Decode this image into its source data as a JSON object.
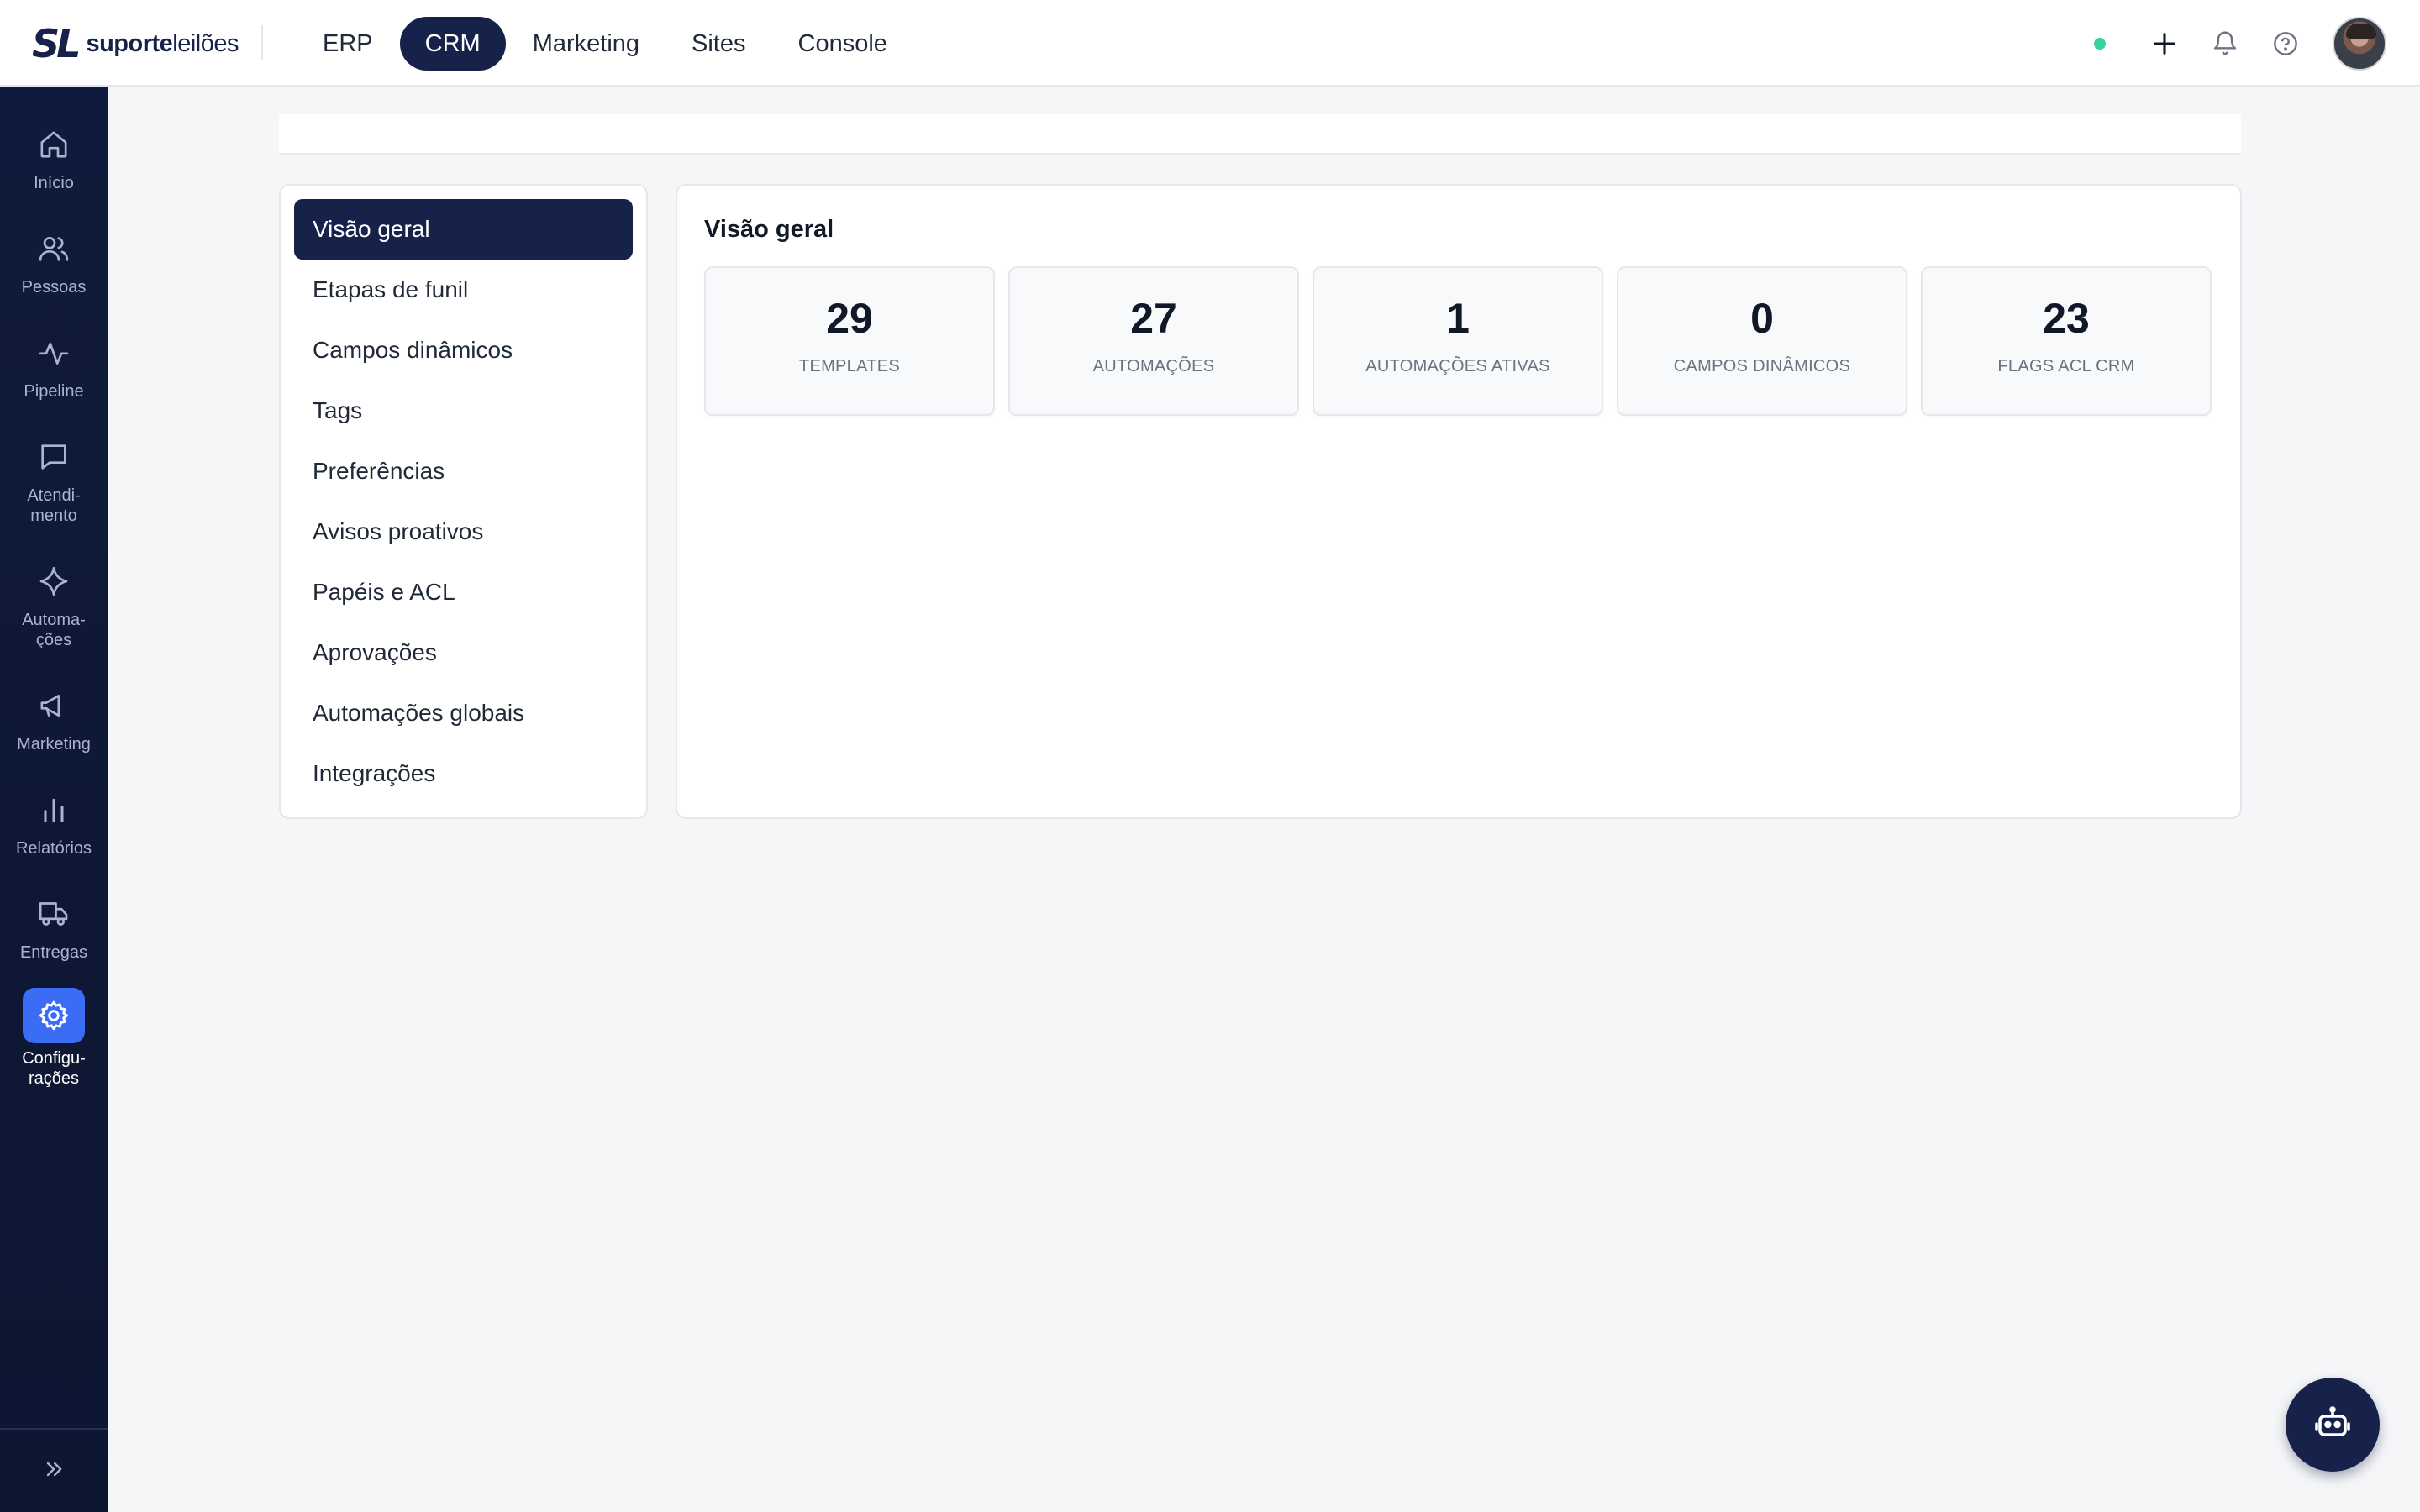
{
  "brand": {
    "mark": "SL",
    "name_bold": "suporte",
    "name_light": "leilões"
  },
  "topnav": {
    "items": [
      {
        "label": "ERP",
        "active": false
      },
      {
        "label": "CRM",
        "active": true
      },
      {
        "label": "Marketing",
        "active": false
      },
      {
        "label": "Sites",
        "active": false
      },
      {
        "label": "Console",
        "active": false
      }
    ]
  },
  "topbar_icons": [
    "status-dot",
    "plus-icon",
    "bell-icon",
    "help-icon",
    "avatar"
  ],
  "sidebar": {
    "items": [
      {
        "label": "Início",
        "icon": "home-icon"
      },
      {
        "label": "Pessoas",
        "icon": "users-icon"
      },
      {
        "label": "Pipeline",
        "icon": "activity-icon"
      },
      {
        "label": "Atendi-\nmento",
        "icon": "message-icon"
      },
      {
        "label": "Automa-\nções",
        "icon": "sparkle-icon"
      },
      {
        "label": "Marketing",
        "icon": "megaphone-icon"
      },
      {
        "label": "Relatórios",
        "icon": "bar-chart-icon"
      },
      {
        "label": "Entregas",
        "icon": "truck-icon"
      },
      {
        "label": "Configu-\nrações",
        "icon": "gear-icon",
        "active": true
      }
    ],
    "collapse_icon": "chevrons-right-icon"
  },
  "submenu": {
    "items": [
      {
        "label": "Visão geral",
        "active": true
      },
      {
        "label": "Etapas de funil"
      },
      {
        "label": "Campos dinâmicos"
      },
      {
        "label": "Tags"
      },
      {
        "label": "Preferências"
      },
      {
        "label": "Avisos proativos"
      },
      {
        "label": "Papéis e ACL"
      },
      {
        "label": "Aprovações"
      },
      {
        "label": "Automações globais"
      },
      {
        "label": "Integrações"
      }
    ]
  },
  "overview": {
    "title": "Visão geral",
    "stats": [
      {
        "value": "29",
        "label": "TEMPLATES"
      },
      {
        "value": "27",
        "label": "AUTOMAÇÕES"
      },
      {
        "value": "1",
        "label": "AUTOMAÇÕES ATIVAS"
      },
      {
        "value": "0",
        "label": "CAMPOS DINÂMICOS"
      },
      {
        "value": "23",
        "label": "FLAGS ACL CRM"
      }
    ]
  },
  "colors": {
    "navy": "#16224a",
    "sidebar_bg": "#101a3c",
    "active_blue": "#3b6cf6",
    "status_green": "#34d399",
    "page_bg": "#f5f6f8"
  },
  "fab_icon": "bot-icon"
}
